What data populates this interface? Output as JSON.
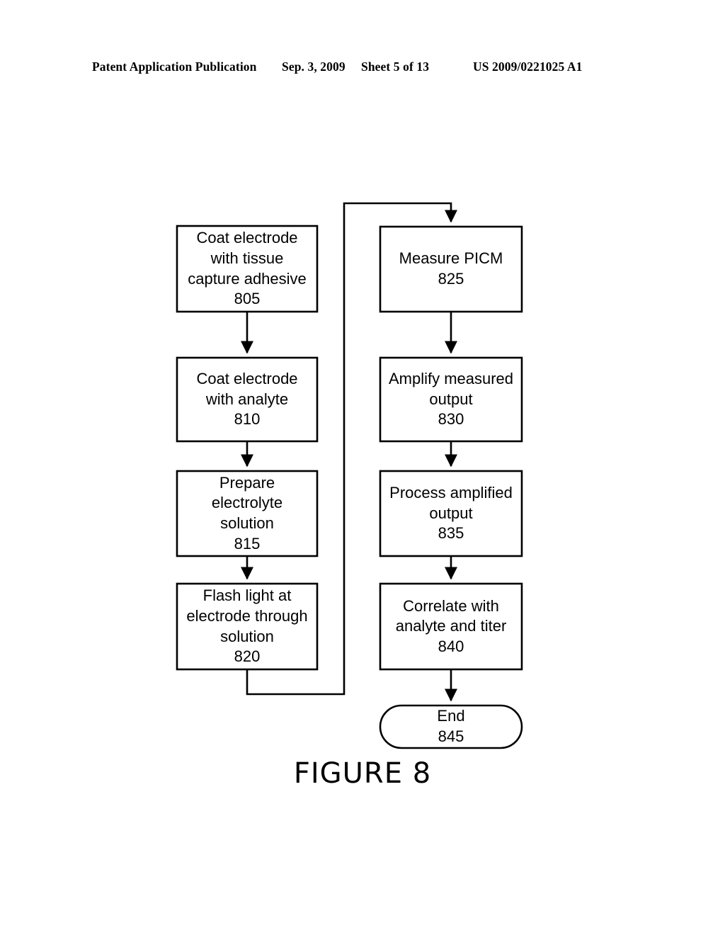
{
  "header": {
    "publication": "Patent Application Publication",
    "date": "Sep. 3, 2009",
    "sheet": "Sheet 5 of 13",
    "patent_number": "US 2009/0221025 A1"
  },
  "figure": {
    "caption": "FIGURE 8",
    "stroke_color": "#000000",
    "fill_color": "#ffffff"
  },
  "flowchart": {
    "type": "flowchart",
    "left_column": [
      {
        "id": "805",
        "shape": "process",
        "lines": [
          "Coat electrode",
          "with tissue",
          "capture adhesive",
          "805"
        ]
      },
      {
        "id": "810",
        "shape": "process",
        "lines": [
          "Coat electrode",
          "with analyte",
          "810"
        ]
      },
      {
        "id": "815",
        "shape": "process",
        "lines": [
          "Prepare",
          "electrolyte",
          "solution",
          "815"
        ]
      },
      {
        "id": "820",
        "shape": "process",
        "lines": [
          "Flash light at",
          "electrode through",
          "solution",
          "820"
        ]
      }
    ],
    "right_column": [
      {
        "id": "825",
        "shape": "process",
        "lines": [
          "Measure PICM",
          "825"
        ]
      },
      {
        "id": "830",
        "shape": "process",
        "lines": [
          "Amplify measured",
          "output",
          "830"
        ]
      },
      {
        "id": "835",
        "shape": "process",
        "lines": [
          "Process amplified",
          "output",
          "835"
        ]
      },
      {
        "id": "840",
        "shape": "process",
        "lines": [
          "Correlate with",
          "analyte and titer",
          "840"
        ]
      },
      {
        "id": "845",
        "shape": "terminator",
        "lines": [
          "End",
          "845"
        ]
      }
    ],
    "connections": [
      {
        "from": "805",
        "to": "810",
        "style": "straight-down"
      },
      {
        "from": "810",
        "to": "815",
        "style": "straight-down"
      },
      {
        "from": "815",
        "to": "820",
        "style": "straight-down"
      },
      {
        "from": "820",
        "to": "825",
        "style": "routed-around-left-column"
      },
      {
        "from": "825",
        "to": "830",
        "style": "straight-down"
      },
      {
        "from": "830",
        "to": "835",
        "style": "straight-down"
      },
      {
        "from": "835",
        "to": "840",
        "style": "straight-down"
      },
      {
        "from": "840",
        "to": "845",
        "style": "straight-down"
      }
    ]
  }
}
